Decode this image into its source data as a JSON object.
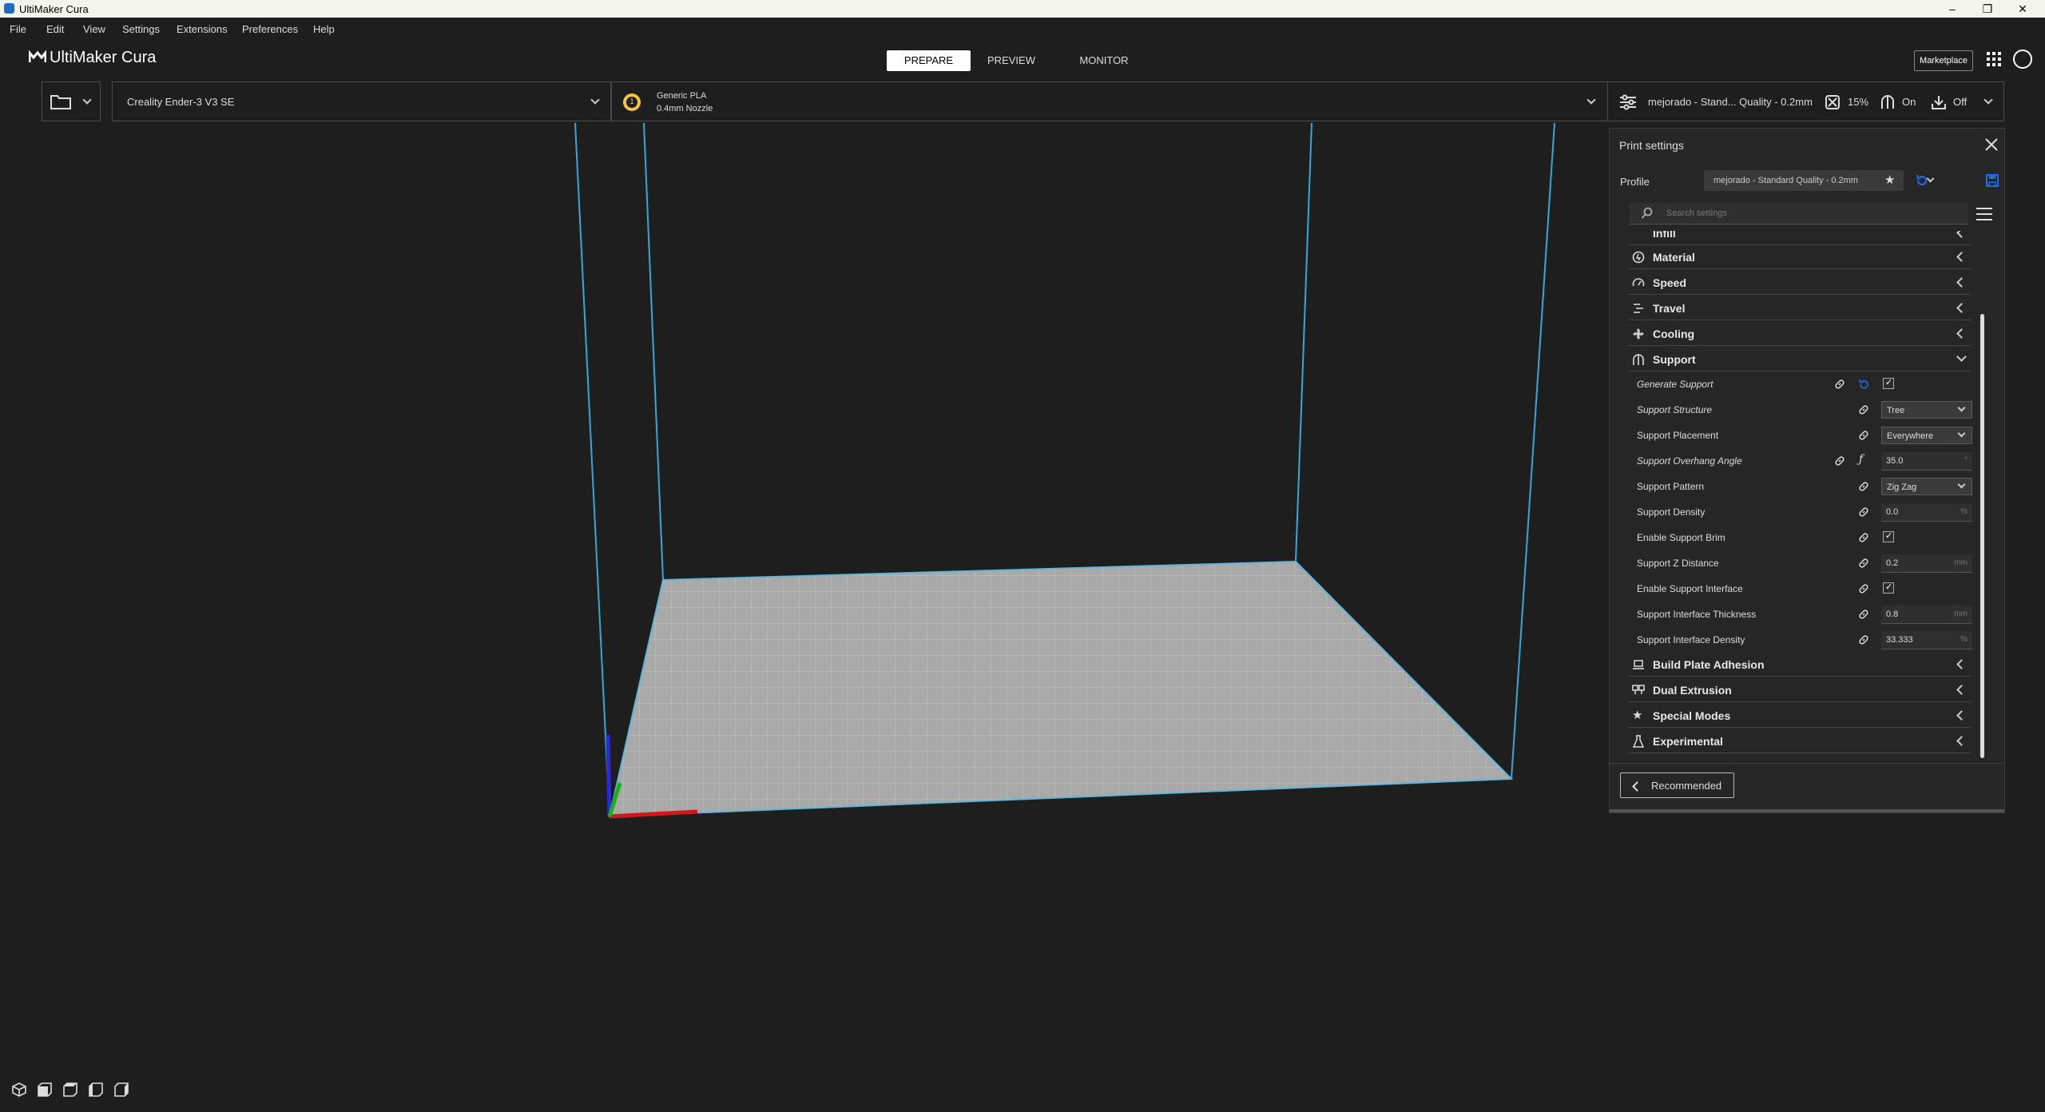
{
  "window": {
    "title": "UltiMaker Cura"
  },
  "menu": [
    "File",
    "Edit",
    "View",
    "Settings",
    "Extensions",
    "Preferences",
    "Help"
  ],
  "header": {
    "logo": "UltiMaker Cura",
    "stages": [
      "PREPARE",
      "PREVIEW",
      "MONITOR"
    ],
    "active_stage": "PREPARE",
    "marketplace": "Marketplace"
  },
  "toolbar": {
    "printer": "Creality Ender-3 V3 SE",
    "extruder_number": "1",
    "material": "Generic PLA",
    "nozzle": "0.4mm Nozzle",
    "profile_summary": "mejorado - Stand... Quality - 0.2mm",
    "infill": "15%",
    "support": "On",
    "adhesion": "Off"
  },
  "print_settings": {
    "title": "Print settings",
    "profile_label": "Profile",
    "profile_value": "mejorado - Standard Quality - 0.2mm",
    "search_placeholder": "Search settings",
    "partial_section": "Infill",
    "sections_top": [
      "Material",
      "Speed",
      "Travel",
      "Cooling"
    ],
    "support_section": "Support",
    "settings": [
      {
        "label": "Generate Support",
        "italic": true,
        "type": "check",
        "checked": true,
        "value": "",
        "unit": ""
      },
      {
        "label": "Support Structure",
        "italic": true,
        "type": "select",
        "value": "Tree",
        "unit": ""
      },
      {
        "label": "Support Placement",
        "italic": false,
        "type": "select",
        "value": "Everywhere",
        "unit": ""
      },
      {
        "label": "Support Overhang Angle",
        "italic": true,
        "type": "number",
        "value": "35.0",
        "unit": "°"
      },
      {
        "label": "Support Pattern",
        "italic": false,
        "type": "select",
        "value": "Zig Zag",
        "unit": ""
      },
      {
        "label": "Support Density",
        "italic": false,
        "type": "number",
        "value": "0.0",
        "unit": "%"
      },
      {
        "label": "Enable Support Brim",
        "italic": false,
        "type": "check",
        "checked": true,
        "value": "",
        "unit": ""
      },
      {
        "label": "Support Z Distance",
        "italic": false,
        "type": "number",
        "value": "0.2",
        "unit": "mm"
      },
      {
        "label": "Enable Support Interface",
        "italic": false,
        "type": "check",
        "checked": true,
        "value": "",
        "unit": ""
      },
      {
        "label": "Support Interface Thickness",
        "italic": false,
        "type": "number",
        "value": "0.8",
        "unit": "mm"
      },
      {
        "label": "Support Interface Density",
        "italic": false,
        "type": "number",
        "value": "33.333",
        "unit": "%"
      }
    ],
    "sections_bottom": [
      "Build Plate Adhesion",
      "Dual Extrusion",
      "Special Modes",
      "Experimental"
    ],
    "recommended_button": "Recommended"
  },
  "colors": {
    "accent": "#196ef0",
    "background": "#1e1e1e",
    "panel": "#262626",
    "build_volume_edge": "#4bb8e6"
  }
}
